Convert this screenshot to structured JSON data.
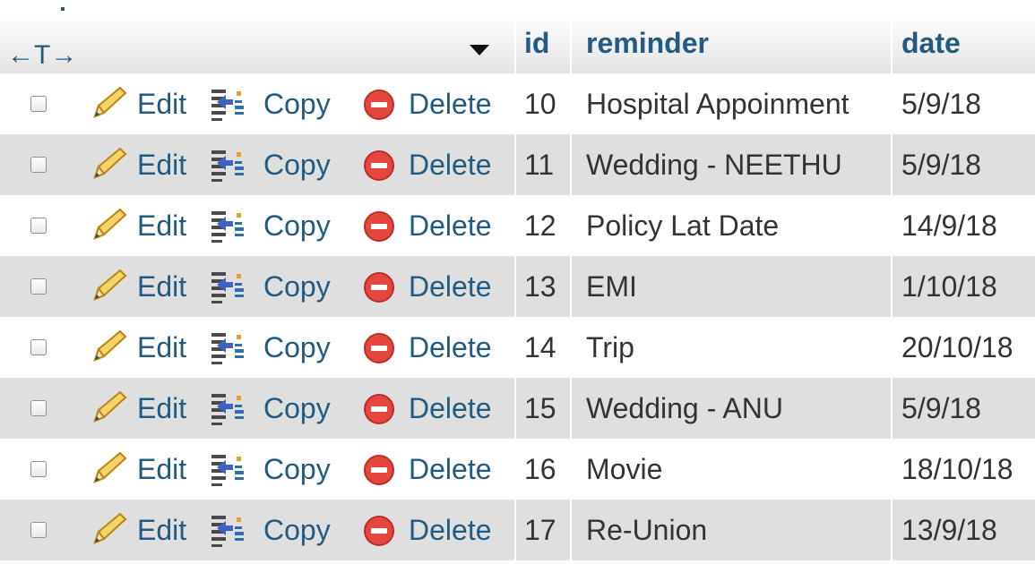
{
  "table": {
    "header": {
      "arrows_label": "←T→",
      "id_label": "id",
      "reminder_label": "reminder",
      "date_label": "date"
    },
    "actions": {
      "edit_label": "Edit",
      "copy_label": "Copy",
      "delete_label": "Delete"
    },
    "rows": [
      {
        "id": "10",
        "reminder": "Hospital Appoinment",
        "date": "5/9/18"
      },
      {
        "id": "11",
        "reminder": "Wedding - NEETHU",
        "date": "5/9/18"
      },
      {
        "id": "12",
        "reminder": "Policy Lat Date",
        "date": "14/9/18"
      },
      {
        "id": "13",
        "reminder": "EMI",
        "date": "1/10/18"
      },
      {
        "id": "14",
        "reminder": "Trip",
        "date": "20/10/18"
      },
      {
        "id": "15",
        "reminder": "Wedding - ANU",
        "date": "5/9/18"
      },
      {
        "id": "16",
        "reminder": "Movie",
        "date": "18/10/18"
      },
      {
        "id": "17",
        "reminder": "Re-Union",
        "date": "13/9/18"
      }
    ]
  },
  "colors": {
    "link": "#235a81",
    "text": "#333333",
    "row_even": "#dfdfdf",
    "row_odd": "#ffffff",
    "delete_icon": "#e5473e"
  },
  "icons": {
    "edit": "pencil-icon",
    "copy": "copy-icon",
    "delete": "delete-icon",
    "sort": "sort-arrow-icon"
  }
}
